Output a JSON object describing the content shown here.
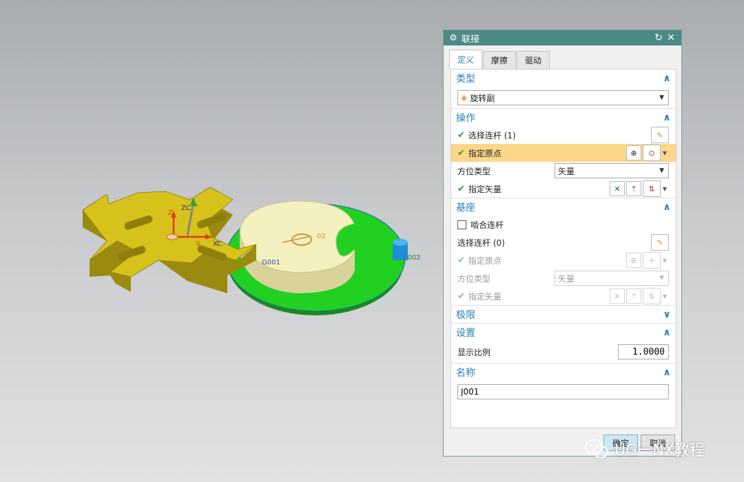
{
  "viewport": {
    "labels": {
      "zc": "ZC",
      "z": "Z",
      "x": "X",
      "xc": "XC",
      "g001": "G001",
      "l002": "L002",
      "o2": "02"
    }
  },
  "dialog": {
    "title": "联接",
    "tabs": [
      {
        "label": "定义"
      },
      {
        "label": "摩擦"
      },
      {
        "label": "驱动"
      }
    ],
    "type_group": {
      "title": "类型",
      "selected": "旋转副"
    },
    "operation_group": {
      "title": "操作",
      "select_link": "选择连杆 (1)",
      "specify_origin": "指定原点",
      "orientation_type_label": "方位类型",
      "orientation_type_value": "矢量",
      "specify_vector": "指定矢量"
    },
    "base_group": {
      "title": "基座",
      "mesh_link": "啮合连杆",
      "select_link": "选择连杆 (0)",
      "specify_origin": "指定原点",
      "orientation_type_label": "方位类型",
      "orientation_type_value": "矢量",
      "specify_vector": "指定矢量"
    },
    "limits_group": {
      "title": "极限"
    },
    "settings_group": {
      "title": "设置",
      "display_scale_label": "显示比例",
      "display_scale_value": "1.0000"
    },
    "name_group": {
      "title": "名称",
      "name_value": "J001"
    },
    "ok_label": "确定",
    "cancel_label": "取消"
  },
  "watermark": {
    "text": "UG一NX教程"
  },
  "colors": {
    "title_bar": "#4c8a86",
    "accent_blue": "#2a7fb6",
    "highlight_row": "#fcd78a",
    "check_green": "#2f9f3a"
  }
}
